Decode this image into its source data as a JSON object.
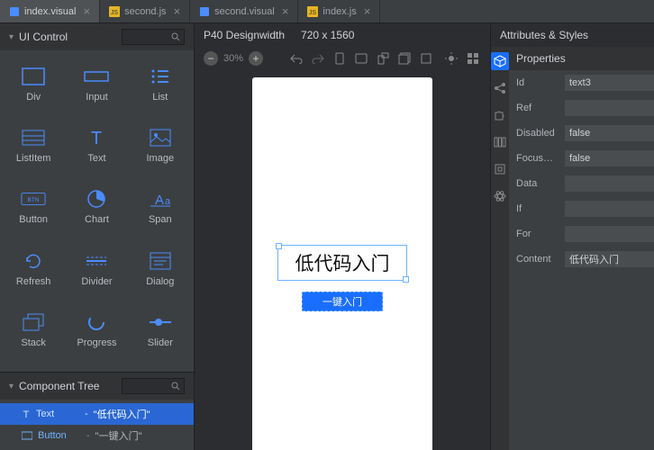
{
  "tabs": [
    {
      "label": "index.visual",
      "icon": "visual",
      "active": true
    },
    {
      "label": "second.js",
      "icon": "js",
      "active": false
    },
    {
      "label": "second.visual",
      "icon": "visual",
      "active": false
    },
    {
      "label": "index.js",
      "icon": "js",
      "active": false
    }
  ],
  "left": {
    "ui_control_title": "UI Control",
    "controls": [
      {
        "label": "Div",
        "icon": "div"
      },
      {
        "label": "Input",
        "icon": "input"
      },
      {
        "label": "List",
        "icon": "list"
      },
      {
        "label": "ListItem",
        "icon": "listitem"
      },
      {
        "label": "Text",
        "icon": "text"
      },
      {
        "label": "Image",
        "icon": "image"
      },
      {
        "label": "Button",
        "icon": "button"
      },
      {
        "label": "Chart",
        "icon": "chart"
      },
      {
        "label": "Span",
        "icon": "span"
      },
      {
        "label": "Refresh",
        "icon": "refresh"
      },
      {
        "label": "Divider",
        "icon": "divider"
      },
      {
        "label": "Dialog",
        "icon": "dialog"
      },
      {
        "label": "Stack",
        "icon": "stack"
      },
      {
        "label": "Progress",
        "icon": "progress"
      },
      {
        "label": "Slider",
        "icon": "slider"
      }
    ],
    "tree_title": "Component Tree",
    "tree": [
      {
        "type": "Text",
        "value": "\"低代码入门\"",
        "selected": true
      },
      {
        "type": "Button",
        "value": "\"一键入门\"",
        "selected": false
      }
    ]
  },
  "center": {
    "device_label": "P40 Designwidth",
    "dimensions": "720 x 1560",
    "zoom": "30%",
    "canvas": {
      "text_content": "低代码入门",
      "button_content": "一键入门"
    }
  },
  "right": {
    "title": "Attributes & Styles",
    "section": "Properties",
    "props": [
      {
        "label": "Id",
        "value": "text3"
      },
      {
        "label": "Ref",
        "value": ""
      },
      {
        "label": "Disabled",
        "value": "false"
      },
      {
        "label": "Focus…",
        "value": "false"
      },
      {
        "label": "Data",
        "value": ""
      },
      {
        "label": "If",
        "value": ""
      },
      {
        "label": "For",
        "value": ""
      },
      {
        "label": "Content",
        "value": "低代码入门"
      }
    ]
  }
}
